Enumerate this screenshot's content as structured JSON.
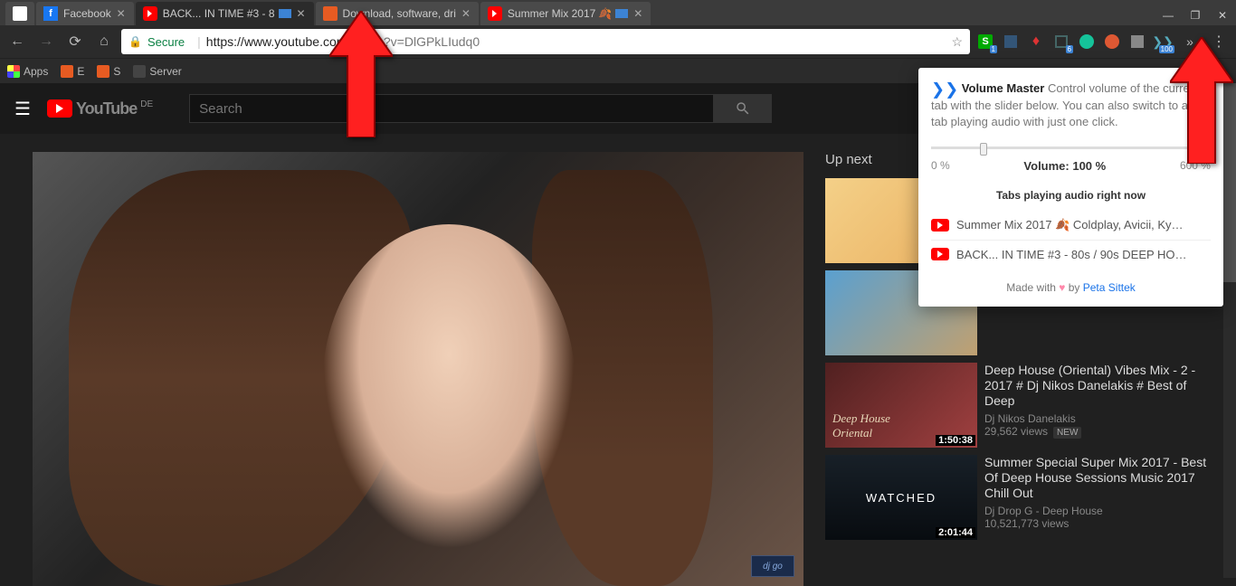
{
  "tabs": [
    {
      "label": "",
      "favicon": "newtab"
    },
    {
      "label": "Facebook",
      "favicon": "fb"
    },
    {
      "label": "BACK... IN TIME #3 - 8",
      "favicon": "yt",
      "active": true,
      "audio": true
    },
    {
      "label": "Download, software, dri",
      "favicon": "dl"
    },
    {
      "label": "Summer Mix 2017",
      "favicon": "yt",
      "audio": true,
      "leaf": true
    }
  ],
  "window": {
    "min": "—",
    "max": "❐",
    "close": "✕"
  },
  "nav": {
    "secure": "Secure",
    "url_host": "https://www.youtube.com",
    "url_path": "/watch?v=DlGPkLIudq0"
  },
  "bookmarks": [
    {
      "label": "Apps",
      "icon": "apps"
    },
    {
      "label": "E"
    },
    {
      "label": "S"
    },
    {
      "label": "Server",
      "icon": "server"
    }
  ],
  "ext_badges": {
    "g": "1",
    "shield": "6",
    "vm": "100"
  },
  "yt": {
    "logo": "YouTube",
    "region": "DE",
    "search_placeholder": "Search",
    "upnext": "Up next",
    "videos": [
      {
        "title": "",
        "channel": "",
        "views": "",
        "dur": ""
      },
      {
        "title": "",
        "channel": "",
        "views": "",
        "dur": ""
      },
      {
        "title": "Deep House (Oriental) Vibes Mix - 2 - 2017 # Dj Nikos Danelakis # Best of Deep",
        "channel": "Dj Nikos Danelakis",
        "views": "29,562 views",
        "dur": "1:50:38",
        "new": "NEW"
      },
      {
        "title": "Summer Special Super Mix 2017 - Best Of Deep House Sessions Music 2017 Chill Out",
        "channel": "Dj Drop G - Deep House",
        "views": "10,521,773 views",
        "dur": "2:01:44",
        "watched": "WATCHED"
      }
    ],
    "dj_logo": "dj go"
  },
  "vm": {
    "icon": "❯❯",
    "title": "Volume Master",
    "desc": "Control volume of the current tab with the slider below. You can also switch to any tab playing audio with just one click.",
    "scale_min": "0 %",
    "scale_max": "600 %",
    "volume": "Volume: 100 %",
    "section": "Tabs playing audio right now",
    "tabs": [
      "Summer Mix 2017 🍂 Coldplay, Avicii, Ky…",
      "BACK... IN TIME #3 - 80s / 90s DEEP HO…"
    ],
    "made": "Made with",
    "by": "by",
    "author": "Peta Sittek"
  }
}
